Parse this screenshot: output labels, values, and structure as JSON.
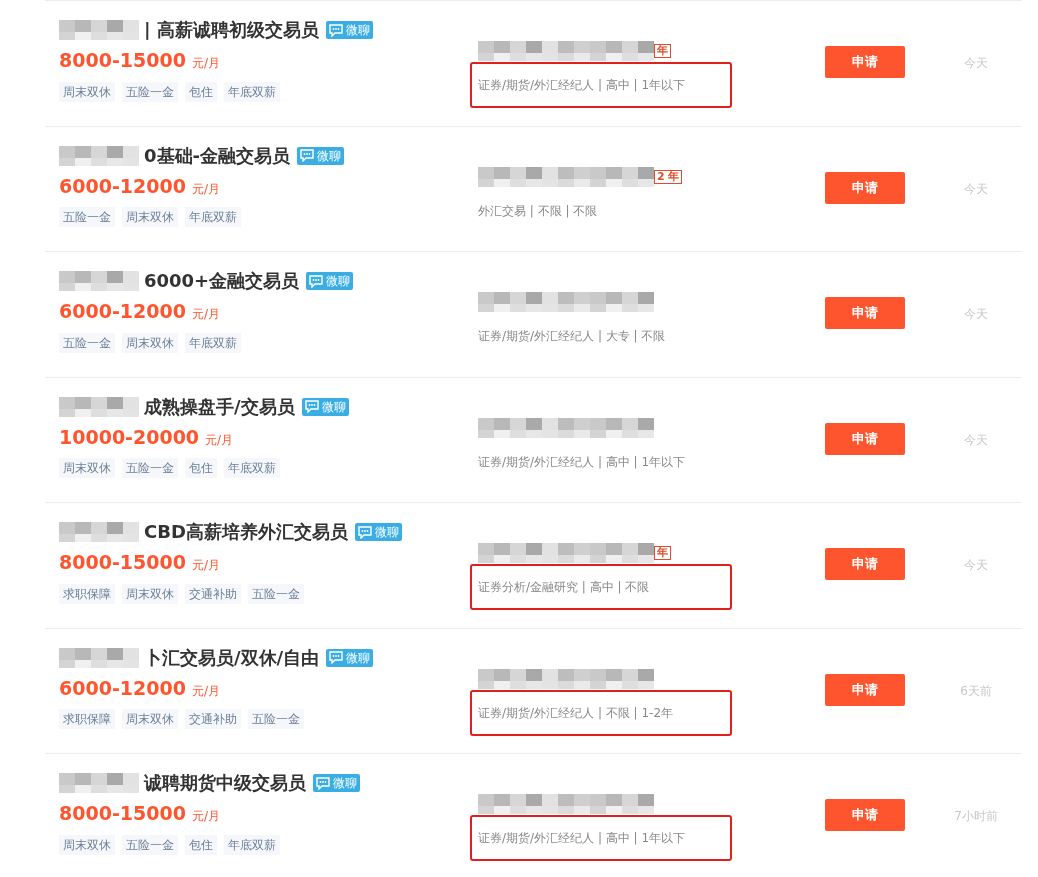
{
  "jobs": [
    {
      "title": "| 高薪诚聘初级交易员",
      "chat": "微聊",
      "salary": "8000-15000",
      "unit": "元/月",
      "tags": [
        "周末双休",
        "五险一金",
        "包住",
        "年底双薪"
      ],
      "company_badge": "年",
      "details": "证券/期货/外汇经纪人 | 高中 | 1年以下",
      "highlighted": true,
      "apply": "申请",
      "time": "今天"
    },
    {
      "title": "0基础-金融交易员",
      "chat": "微聊",
      "salary": "6000-12000",
      "unit": "元/月",
      "tags": [
        "五险一金",
        "周末双休",
        "年底双薪"
      ],
      "company_badge": "2 年",
      "details": "外汇交易 | 不限 | 不限",
      "highlighted": false,
      "apply": "申请",
      "time": "今天"
    },
    {
      "title": "6000+金融交易员",
      "chat": "微聊",
      "salary": "6000-12000",
      "unit": "元/月",
      "tags": [
        "五险一金",
        "周末双休",
        "年底双薪"
      ],
      "details": "证券/期货/外汇经纪人 | 大专 | 不限",
      "highlighted": false,
      "apply": "申请",
      "time": "今天"
    },
    {
      "title": "成熟操盘手/交易员",
      "chat": "微聊",
      "salary": "10000-20000",
      "unit": "元/月",
      "tags": [
        "周末双休",
        "五险一金",
        "包住",
        "年底双薪"
      ],
      "details": "证券/期货/外汇经纪人 | 高中 | 1年以下",
      "highlighted": false,
      "apply": "申请",
      "time": "今天"
    },
    {
      "title": "CBD高薪培养外汇交易员",
      "chat": "微聊",
      "salary": "8000-15000",
      "unit": "元/月",
      "tags": [
        "求职保障",
        "周末双休",
        "交通补助",
        "五险一金"
      ],
      "company_badge": "年",
      "details": "证券分析/金融研究 | 高中 | 不限",
      "highlighted": true,
      "apply": "申请",
      "time": "今天"
    },
    {
      "title": "卜汇交易员/双休/自由",
      "chat": "微聊",
      "salary": "6000-12000",
      "unit": "元/月",
      "tags": [
        "求职保障",
        "周末双休",
        "交通补助",
        "五险一金"
      ],
      "details": "证券/期货/外汇经纪人 | 不限 | 1-2年",
      "highlighted": true,
      "apply": "申请",
      "time": "6天前"
    },
    {
      "title": "诚聘期货中级交易员",
      "chat": "微聊",
      "salary": "8000-15000",
      "unit": "元/月",
      "tags": [
        "周末双休",
        "五险一金",
        "包住",
        "年底双薪"
      ],
      "details": "证券/期货/外汇经纪人 | 高中 | 1年以下",
      "highlighted": true,
      "apply": "申请",
      "time": "7小时前"
    }
  ]
}
